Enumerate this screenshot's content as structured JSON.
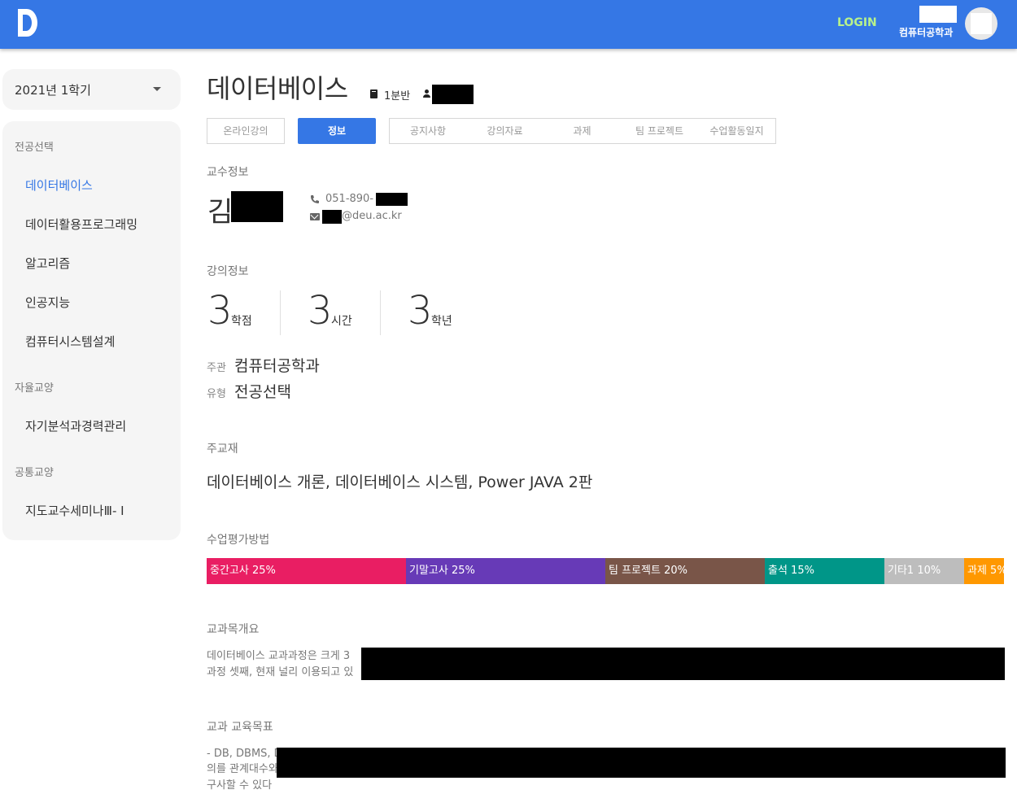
{
  "header": {
    "logo_icon": "d-logo-icon",
    "login_label": "LOGIN",
    "user_department": "컴퓨터공학과",
    "colors": {
      "bar": "#3577e5",
      "login": "#b8f28a"
    }
  },
  "sidebar": {
    "semester": "2021년 1학기",
    "groups": [
      {
        "category": "전공선택",
        "items": [
          "데이터베이스",
          "데이터활용프로그래밍",
          "알고리즘",
          "인공지능",
          "컴퓨터시스템설계"
        ]
      },
      {
        "category": "자율교양",
        "items": [
          "자기분석과경력관리"
        ]
      },
      {
        "category": "공통교양",
        "items": [
          "지도교수세미나Ⅲ- Ⅰ"
        ]
      }
    ],
    "active_item": "데이터베이스"
  },
  "course": {
    "title": "데이터베이스",
    "class_section": "1분반"
  },
  "tabs": {
    "online": "온라인강의",
    "info": "정보",
    "group": [
      "공지사항",
      "강의자료",
      "과제",
      "팀 프로젝트",
      "수업활동일지"
    ],
    "active": "정보"
  },
  "professor": {
    "section_label": "교수정보",
    "name_initial": "김",
    "phone_prefix": "051-890-",
    "email_suffix": "@deu.ac.kr"
  },
  "lecture": {
    "section_label": "강의정보",
    "stats": [
      {
        "value": "3",
        "unit": "학점"
      },
      {
        "value": "3",
        "unit": "시간"
      },
      {
        "value": "3",
        "unit": "학년"
      }
    ],
    "host_key": "주관",
    "host_value": "컴퓨터공학과",
    "type_key": "유형",
    "type_value": "전공선택"
  },
  "textbook": {
    "section_label": "주교재",
    "value": "데이터베이스 개론, 데이터베이스 시스템, Power JAVA 2판"
  },
  "evaluation": {
    "section_label": "수업평가방법",
    "segments": [
      {
        "label": "중간고사 25%",
        "percent": 25,
        "color": "#e91e63"
      },
      {
        "label": "기말고사 25%",
        "percent": 25,
        "color": "#673ab7"
      },
      {
        "label": "팀 프로젝트 20%",
        "percent": 20,
        "color": "#795548"
      },
      {
        "label": "출석 15%",
        "percent": 15,
        "color": "#009688"
      },
      {
        "label": "기타1 10%",
        "percent": 10,
        "color": "#bdbdbd"
      },
      {
        "label": "과제 5%",
        "percent": 5,
        "color": "#ff9800"
      }
    ]
  },
  "overview": {
    "section_label": "교과목개요",
    "lines": [
      "데이터베이스 교과과정은 크게 3",
      "과정 셋째, 현재 널리 이용되고 있"
    ]
  },
  "goals": {
    "section_label": "교과 교육목표",
    "lines": [
      "- DB, DBMS, D",
      "의를 관계대수와",
      "구사할 수 있다"
    ]
  }
}
